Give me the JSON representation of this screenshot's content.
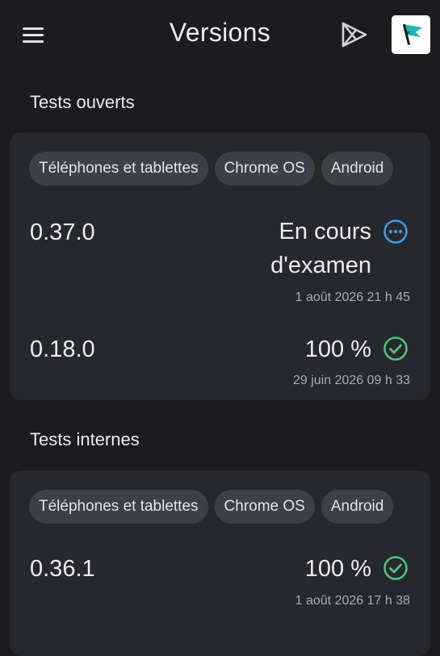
{
  "header": {
    "title": "Versions",
    "menu_icon": "menu-icon",
    "play_icon": "play-store-icon",
    "avatar_icon": "app-logo-flag-icon"
  },
  "sections": [
    {
      "title": "Tests ouverts",
      "chips": [
        "Téléphones et tablettes",
        "Chrome OS",
        "Android"
      ],
      "releases": [
        {
          "version": "0.37.0",
          "status_line1": "En cours",
          "status_line2": "d'examen",
          "status_icon": "in-review-more-icon",
          "date": "1 août 2026 21 h 45"
        },
        {
          "version": "0.18.0",
          "status_line1": "100 %",
          "status_icon": "check-circle-icon",
          "date": "29 juin 2026 09 h 33"
        }
      ]
    },
    {
      "title": "Tests internes",
      "chips": [
        "Téléphones et tablettes",
        "Chrome OS",
        "Android"
      ],
      "releases": [
        {
          "version": "0.36.1",
          "status_line1": "100 %",
          "status_icon": "check-circle-icon",
          "date": "1 août 2026 17 h 38"
        }
      ]
    }
  ],
  "colors": {
    "background": "#1c1c20",
    "card": "#27282d",
    "chip": "#3d3f49",
    "review_blue": "#3a9ae8",
    "success_green": "#4fc17a",
    "avatar_flag": "#1fb8b8"
  }
}
